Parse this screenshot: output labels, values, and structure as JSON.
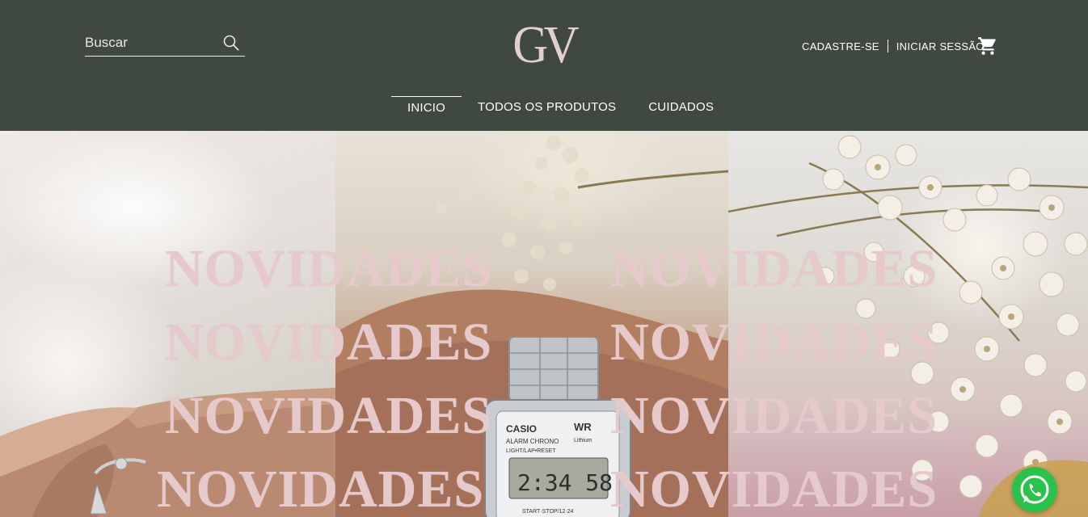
{
  "header": {
    "search": {
      "placeholder": "Buscar",
      "icon": "search-icon"
    },
    "logo_text": "GV",
    "account": {
      "register_label": "CADASTRE-SE",
      "login_label": "INICIAR SESSÃO",
      "cart_icon": "cart-icon"
    },
    "nav": [
      {
        "label": "INICIO",
        "active": true
      },
      {
        "label": "TODOS OS PRODUTOS",
        "active": false
      },
      {
        "label": "CUIDADOS",
        "active": false
      }
    ]
  },
  "hero": {
    "banner_text": "NOVIDADES",
    "watch": {
      "brand": "CASIO",
      "badge": "WR",
      "line1": "ALARM CHRONO",
      "line2": "LIGHT/LAP•RESET",
      "time": "2:34 58",
      "line3": "START·STOP/12·24",
      "extra": "Lithium"
    }
  },
  "colors": {
    "header_bg": "#3f4942",
    "logo": "#e3cfcf",
    "banner_text": "#e6c9cb",
    "whatsapp": "#2bc24c"
  },
  "whatsapp": {
    "icon": "whatsapp-icon"
  }
}
